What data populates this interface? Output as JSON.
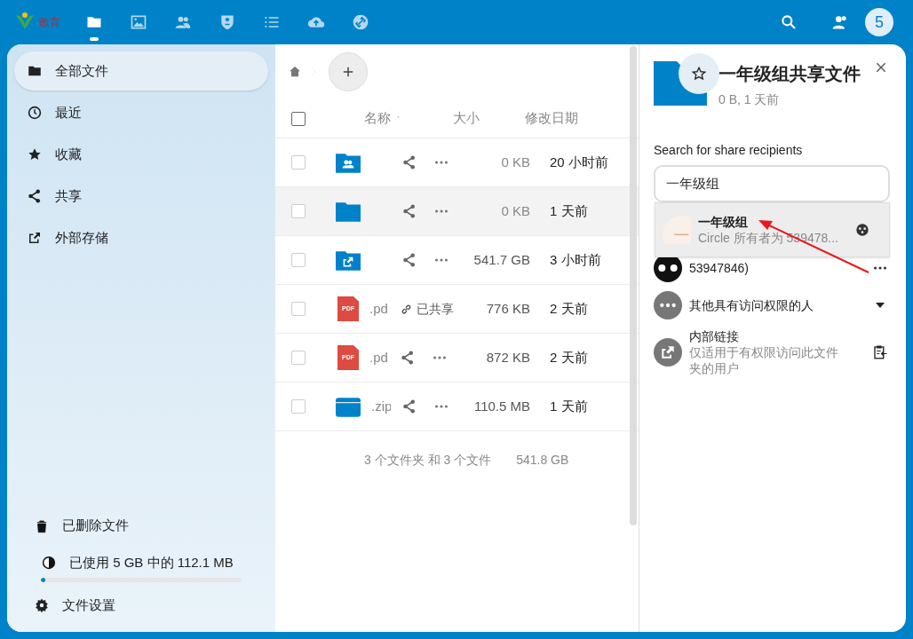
{
  "header": {
    "logo_text": "教育",
    "apps": [
      {
        "kind": "files",
        "selected": true
      },
      {
        "kind": "photos",
        "selected": false
      },
      {
        "kind": "contacts",
        "selected": false
      },
      {
        "kind": "shield",
        "selected": false
      },
      {
        "kind": "list",
        "selected": false
      },
      {
        "kind": "upload",
        "selected": false
      },
      {
        "kind": "link",
        "selected": false
      }
    ],
    "avatar": "5"
  },
  "sidebar": {
    "items": [
      {
        "kind": "folder",
        "label": "全部文件",
        "selected": true
      },
      {
        "kind": "clock",
        "label": "最近",
        "selected": false
      },
      {
        "kind": "star",
        "label": "收藏",
        "selected": false
      },
      {
        "kind": "share",
        "label": "共享",
        "selected": false
      },
      {
        "kind": "external",
        "label": "外部存储",
        "selected": false
      }
    ],
    "trash": "已删除文件",
    "quota": {
      "label": "已使用 5 GB 中的 112.1 MB",
      "level": 0.02
    },
    "settings": "文件设置"
  },
  "files": {
    "columns": [
      "名称",
      "大小",
      "修改日期"
    ],
    "all_checked": false,
    "rows": [
      {
        "kind": "shared-folder",
        "checked": false,
        "name": "",
        "shared_label": "",
        "size": "0 KB",
        "date": "20 小时前",
        "selected": false
      },
      {
        "kind": "folder",
        "checked": false,
        "name": "",
        "shared_label": "",
        "size": "0 KB",
        "date": "1 天前",
        "selected": true
      },
      {
        "kind": "external-folder",
        "checked": false,
        "name": "",
        "shared_label": "",
        "size": "541.7 GB",
        "date": "3 小时前",
        "selected": false
      },
      {
        "kind": "pdf",
        "checked": false,
        "icon_label": "PDF",
        "name": ".pd",
        "shared_label": "已共享",
        "size": "776 KB",
        "date": "2 天前",
        "selected": false
      },
      {
        "kind": "pdf",
        "checked": false,
        "icon_label": "PDF",
        "name": ".pd",
        "shared_label": "",
        "size": "872 KB",
        "date": "2 天前",
        "selected": false
      },
      {
        "kind": "zip",
        "checked": false,
        "name": ".zip",
        "shared_label": "",
        "size": "110.5 MB",
        "date": "1 天前",
        "selected": false
      }
    ],
    "summary": "3 个文件夹 和 3 个文件",
    "summary_size": "541.8 GB"
  },
  "details": {
    "title": "一年级组共享文件",
    "subtitle": "0 B, 1 天前",
    "search_label": "Search for share recipients",
    "search_value": "一年级组",
    "suggestion": {
      "name": "一年级组",
      "detail": "Circle 所有者为 539478..."
    },
    "shares": [
      {
        "kind": "circle",
        "text": "53947846)"
      },
      {
        "kind": "others",
        "text": "其他具有访问权限的人"
      },
      {
        "kind": "internal",
        "text": "内部链接",
        "detail": "仅适用于有权限访问此文件夹的用户"
      }
    ]
  }
}
